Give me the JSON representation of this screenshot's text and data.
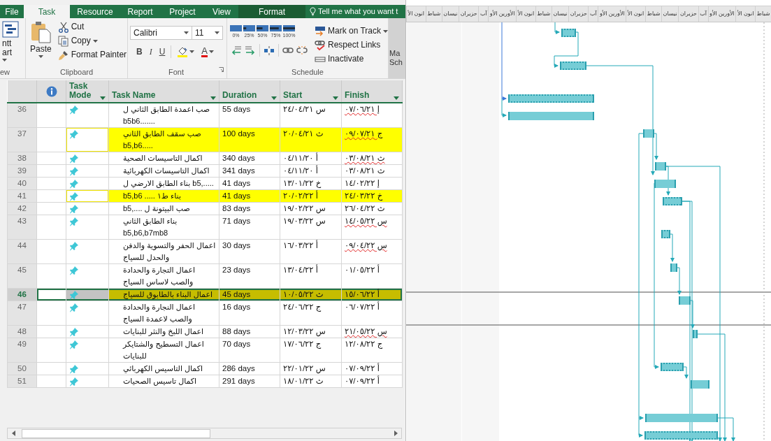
{
  "tabs": [
    {
      "label": "Format",
      "kind": "contextual",
      "selected": false
    },
    {
      "label": "View",
      "kind": "tab",
      "selected": false
    },
    {
      "label": "Project",
      "kind": "tab",
      "selected": false
    },
    {
      "label": "Report",
      "kind": "tab",
      "selected": false
    },
    {
      "label": "Resource",
      "kind": "tab",
      "selected": false
    },
    {
      "label": "Task",
      "kind": "tab",
      "selected": true
    },
    {
      "label": "File",
      "kind": "file",
      "selected": false
    }
  ],
  "tell_me": "Tell me what you want t",
  "ribbon": {
    "view": {
      "lines": [
        "ntt",
        "art"
      ],
      "label": "ew"
    },
    "clipboard": {
      "paste": "Paste",
      "cut": "Cut",
      "copy": "Copy",
      "format_painter": "Format Painter",
      "label": "Clipboard"
    },
    "font": {
      "family": "Calibri",
      "size": "11",
      "bold": "B",
      "italic": "I",
      "underline": "U",
      "font_color": "A",
      "label": "Font"
    },
    "schedule": {
      "percent_buttons": [
        "100%",
        "75%",
        "50%",
        "25%",
        "0%"
      ],
      "mark_on_track": "Mark on Track",
      "respect_links": "Respect Links",
      "inactivate": "Inactivate",
      "label": "Schedule"
    },
    "mode": {
      "lines": [
        "Ma",
        "Sch"
      ]
    }
  },
  "table": {
    "columns": [
      {
        "kind": "text",
        "label": "Finish"
      },
      {
        "kind": "text",
        "label": "Start"
      },
      {
        "kind": "text",
        "label": "Duration"
      },
      {
        "kind": "text",
        "label": "Task Name"
      },
      {
        "kind": "text",
        "label": "Task Mode"
      },
      {
        "kind": "info"
      }
    ],
    "rows": [
      {
        "id": "36",
        "name": "صب اعمدة الطابق الثاني ل b5b6.......",
        "duration": "55 days",
        "start": "س ٢٤/٠٤/٢١",
        "finish": "إ ٠٧/٠٦/٢١",
        "highlighted": false,
        "selected": false,
        "finish_flagged": true
      },
      {
        "id": "37",
        "name": "صب سقف الطابق الثاني b5,b6.....",
        "duration": "100 days",
        "start": "ث ٢٠/٠٤/٢١",
        "finish": "ج ٠٩/٠٧/٢١",
        "highlighted": true,
        "selected": false,
        "finish_flagged": true
      },
      {
        "id": "38",
        "name": "اكمال التاسيسات الصحية",
        "duration": "340 days",
        "start": "أ ٠٤/١١/٢٠",
        "finish": "ث ٠٣/٠٨/٢١",
        "highlighted": false,
        "selected": false,
        "finish_flagged": true
      },
      {
        "id": "39",
        "name": "اكمال التاسيسات الكهربائية",
        "duration": "341 days",
        "start": "أ ٠٤/١١/٢٠",
        "finish": "ث ٠٣/٠٨/٢١",
        "highlighted": false,
        "selected": false,
        "finish_flagged": false
      },
      {
        "id": "40",
        "name": "بناء الطابق الارضي ل b5,.....",
        "duration": "41 days",
        "start": "خ ١٣/٠١/٢٢",
        "finish": "إ ١٤/٠٢/٢٢",
        "highlighted": false,
        "selected": false,
        "finish_flagged": false
      },
      {
        "id": "41",
        "name": "b5,b6 ..... بناء ط١",
        "duration": "41 days",
        "start": "أ ٢٠/٠٢/٢٢",
        "finish": "خ ٢٤/٠٣/٢٢",
        "highlighted": true,
        "selected": false,
        "finish_flagged": false
      },
      {
        "id": "42",
        "name": "b5,.... صب البيتونة ل",
        "duration": "83 days",
        "start": "س ١٩/٠٢/٢٢",
        "finish": "ث ٢٦/٠٤/٢٢",
        "highlighted": false,
        "selected": false,
        "finish_flagged": false
      },
      {
        "id": "43",
        "name": "بناء الطابق الثاني b5,b6,b7mb8",
        "duration": "71 days",
        "start": "س ١٩/٠٣/٢٢",
        "finish": "س ١٤/٠٥/٢٢",
        "highlighted": false,
        "selected": false,
        "finish_flagged": true
      },
      {
        "id": "44",
        "name": "اعمال الحفر والتسوية والدفن والحدل للسياج",
        "duration": "30 days",
        "start": "أ ١٦/٠٣/٢٢",
        "finish": "س ٠٩/٠٤/٢٢",
        "highlighted": false,
        "selected": false,
        "finish_flagged": true
      },
      {
        "id": "45",
        "name": "اعمال التجارة والحدادة والصب لاساس السياج",
        "duration": "23 days",
        "start": "أ ١٣/٠٤/٢٢",
        "finish": "أ ٠١/٠٥/٢٢",
        "highlighted": false,
        "selected": false,
        "finish_flagged": false
      },
      {
        "id": "46",
        "name": "اعمال البناء بالطابوق للسياج",
        "duration": "45 days",
        "start": "ث ١٠/٠٥/٢٢",
        "finish": "أ ١٥/٠٦/٢٢",
        "highlighted": false,
        "selected": true,
        "finish_flagged": false
      },
      {
        "id": "47",
        "name": "اعمال النجارة والحدادة والصب لاعمدة السياج",
        "duration": "16 days",
        "start": "ج ٢٤/٠٦/٢٢",
        "finish": "أ ٠٦/٠٧/٢٢",
        "highlighted": false,
        "selected": false,
        "finish_flagged": false
      },
      {
        "id": "48",
        "name": "اعمال اللبخ والنثر للبنايات",
        "duration": "88 days",
        "start": "س ١٢/٠٣/٢٢",
        "finish": "س ٢١/٠٥/٢٢",
        "highlighted": false,
        "selected": false,
        "finish_flagged": true
      },
      {
        "id": "49",
        "name": "اعمال التسطيح والشتايكر للبنايات",
        "duration": "70 days",
        "start": "ج ١٧/٠٦/٢٢",
        "finish": "ج ١٢/٠٨/٢٢",
        "highlighted": false,
        "selected": false,
        "finish_flagged": false
      },
      {
        "id": "50",
        "name": "اكمال التاسيس الكهربائي",
        "duration": "286 days",
        "start": "س ٢٢/٠١/٢٢",
        "finish": "أ ٠٧/٠٩/٢٢",
        "highlighted": false,
        "selected": false,
        "finish_flagged": false
      },
      {
        "id": "51",
        "name": "اكمال تاسيس الصحيات",
        "duration": "291 days",
        "start": "ث ١٨/٠١/٢٢",
        "finish": "أ ٠٧/٠٩/٢٢",
        "highlighted": false,
        "selected": false,
        "finish_flagged": false
      }
    ]
  },
  "timescale": [
    "شباط",
    "انون الأ",
    "الأورين الأو",
    "آب",
    "حزيران",
    "نيسان",
    "شباط",
    "انون الأ",
    "الأورين الأو",
    "آب",
    "حزيران",
    "نيسان",
    "شباط",
    "انون الأ",
    "الأورين الأو",
    "آب",
    "حزيران",
    "نيسان",
    "شباط",
    "انون الأ"
  ]
}
